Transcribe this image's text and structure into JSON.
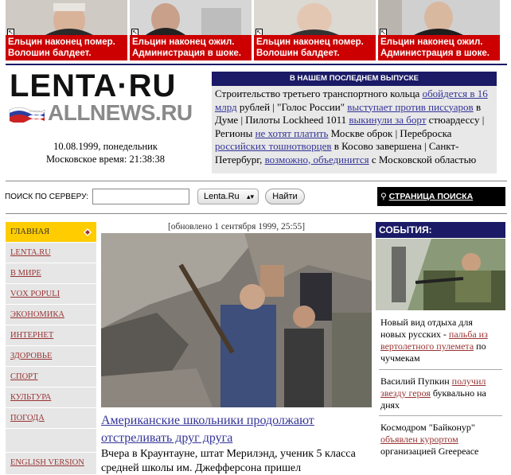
{
  "banners": [
    {
      "line1": "Ельцин наконец помер.",
      "line2": "Волошин балдеет."
    },
    {
      "line1": "Ельцин наконец ожил.",
      "line2": "Администрация в шоке."
    },
    {
      "line1": "Ельцин наконец помер.",
      "line2": "Волошин балдеет."
    },
    {
      "line1": "Ельцин наконец ожил.",
      "line2": "Администрация в шоке."
    }
  ],
  "logo": {
    "main": "LENTA·RU",
    "sub": "ALLNEWS.RU"
  },
  "date": {
    "line1": "10.08.1999, понедельник",
    "line2": "Московское время: 21:38:38"
  },
  "latest": {
    "header": "В НАШЕМ ПОСЛЕДНЕМ ВЫПУСКЕ",
    "t1": "Строительство третьего транспортного кольца ",
    "l1": "обойдется в 16 млрд",
    "t2": " рублей | \"Голос России\" ",
    "l2": "выступает против писсуаров",
    "t3": " в Думе | Пилоты Lockheed 1011 ",
    "l3": "выкинули за борт",
    "t4": " стюардессу | Регионы ",
    "l4": "не хотят платить",
    "t5": " Москве оброк | Переброска ",
    "l5": "российских тошнотворцев",
    "t6": " в Косово завершена | Санкт-Петербург, ",
    "l6": "возможно, объединится",
    "t7": " с Московской областью"
  },
  "search": {
    "label": "ПОИСК ПО СЕРВЕРУ:",
    "value": "",
    "select": "Lenta.Ru",
    "button": "Найти",
    "page_link": "СТРАНИЦА ПОИСКА"
  },
  "nav": [
    "ГЛАВНАЯ",
    "LENTA.RU",
    "В МИРЕ",
    "VOX POPULI",
    "ЭКОНОМИКА",
    "ИНТЕРНЕТ",
    "ЗДОРОВЬЕ",
    "СПОРТ",
    "КУЛЬТУРА",
    "ПОГОДА",
    "",
    "ENGLISH VERSION"
  ],
  "main": {
    "updated": "[обновлено 1 сентября 1999, 25:55]",
    "title": "Американские школьники продолжают отстреливать друг друга",
    "text": "Вчера в Краунтауне, штат Мерилэнд, ученик 5 класса средней школы им. Джефферсона пришел"
  },
  "events": {
    "header": "СОБЫТИЯ:",
    "items": [
      {
        "t1": "Новый вид отдыха для новых русских - ",
        "lk": "пальба из вертолетного пулемета",
        "t2": " по чучмекам"
      },
      {
        "t1": "Василий Пупкин ",
        "lk": "получил звезду героя",
        "t2": " буквально на днях"
      },
      {
        "t1": "Космодром \"Байконур\" ",
        "lk": "объявлен курортом",
        "t2": " организацией Greepeace"
      }
    ]
  },
  "colors": {
    "navy": "#1a1a66",
    "red": "#cc0000",
    "home": "#ffcc00",
    "nav_bg": "#e6e6e6",
    "link": "#333399",
    "nav_link": "#993333"
  }
}
